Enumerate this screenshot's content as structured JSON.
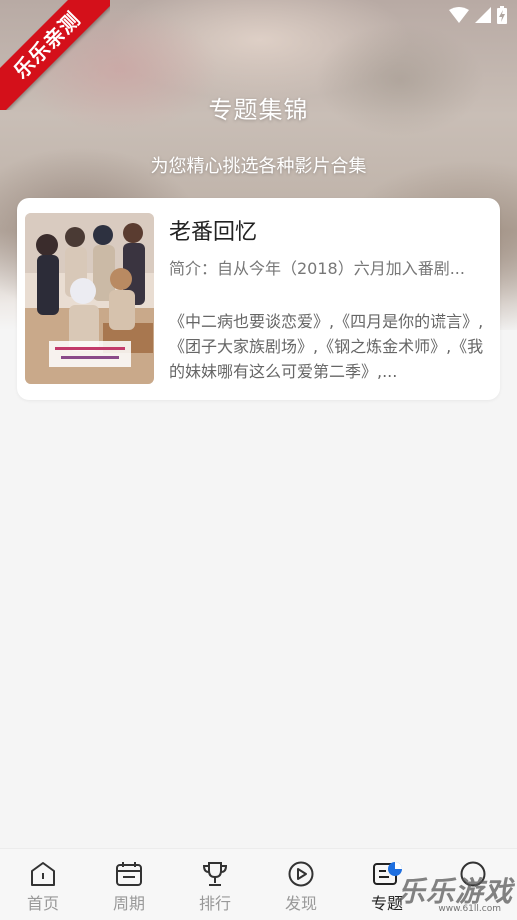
{
  "header": {
    "title": "专题集锦",
    "subtitle": "为您精心挑选各种影片合集"
  },
  "ribbon": {
    "text": "乐乐亲测",
    "color": "#d4101a"
  },
  "status_bar": {
    "icons": [
      "wifi-icon",
      "signal-icon",
      "battery-charging-icon"
    ]
  },
  "topics": [
    {
      "title": "老番回忆",
      "intro": "简介：自从今年（2018）六月加入番剧...",
      "list": "《中二病也要谈恋爱》,《四月是你的谎言》,《团子大家族剧场》,《钢之炼金术师》,《我的妹妹哪有这么可爱第二季》,..."
    }
  ],
  "bottom_nav": {
    "items": [
      {
        "label": "首页",
        "icon": "home-icon"
      },
      {
        "label": "周期",
        "icon": "calendar-icon"
      },
      {
        "label": "排行",
        "icon": "trophy-icon"
      },
      {
        "label": "发现",
        "icon": "play-circle-icon"
      },
      {
        "label": "专题",
        "icon": "topic-icon",
        "active": true
      },
      {
        "label": "",
        "icon": "chat-icon"
      }
    ]
  },
  "watermark": {
    "text": "乐乐游戏",
    "url": "www.61ll.com"
  },
  "colors": {
    "background": "#f5f5f5",
    "card": "#ffffff",
    "accent": "#1e6fe0",
    "nav_inactive": "#999999"
  }
}
